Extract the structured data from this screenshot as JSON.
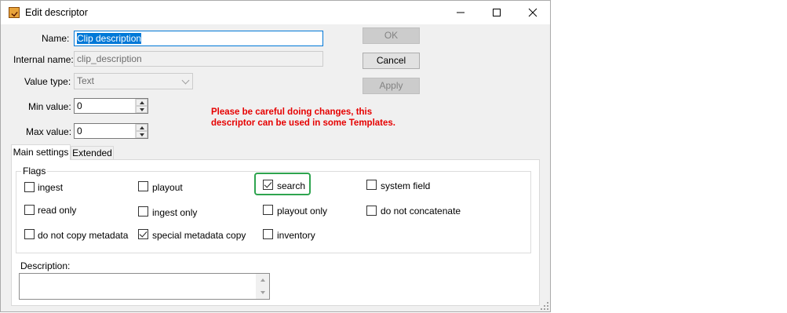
{
  "window": {
    "title": "Edit descriptor",
    "controls": [
      "minimize-icon",
      "maximize-icon",
      "close-icon"
    ]
  },
  "form": {
    "name_label": "Name:",
    "name_value": "Clip description",
    "internal_name_label": "Internal name:",
    "internal_name_value": "clip_description",
    "value_type_label": "Value type:",
    "value_type_value": "Text",
    "min_value_label": "Min value:",
    "min_value": "0",
    "max_value_label": "Max value:",
    "max_value": "0"
  },
  "buttons": {
    "ok": "OK",
    "cancel": "Cancel",
    "apply": "Apply"
  },
  "warning": {
    "line1": "Please be careful doing changes, this",
    "line2": "descriptor can be used in some Templates.",
    "color": "#e60000"
  },
  "tabs": [
    {
      "label": "Main settings",
      "active": true
    },
    {
      "label": "Extended",
      "active": false
    }
  ],
  "flags": {
    "group_label": "Flags",
    "items": [
      {
        "label": "ingest",
        "checked": false
      },
      {
        "label": "playout",
        "checked": false
      },
      {
        "label": "search",
        "checked": true
      },
      {
        "label": "system field",
        "checked": false
      },
      {
        "label": "read only",
        "checked": false
      },
      {
        "label": "ingest only",
        "checked": false
      },
      {
        "label": "playout only",
        "checked": false
      },
      {
        "label": "do not concatenate",
        "checked": false
      },
      {
        "label": "do not copy metadata",
        "checked": false
      },
      {
        "label": "special metadata copy",
        "checked": true
      },
      {
        "label": "inventory",
        "checked": false
      }
    ],
    "highlight_color": "#2ea44f"
  },
  "description": {
    "label": "Description:",
    "value": ""
  }
}
